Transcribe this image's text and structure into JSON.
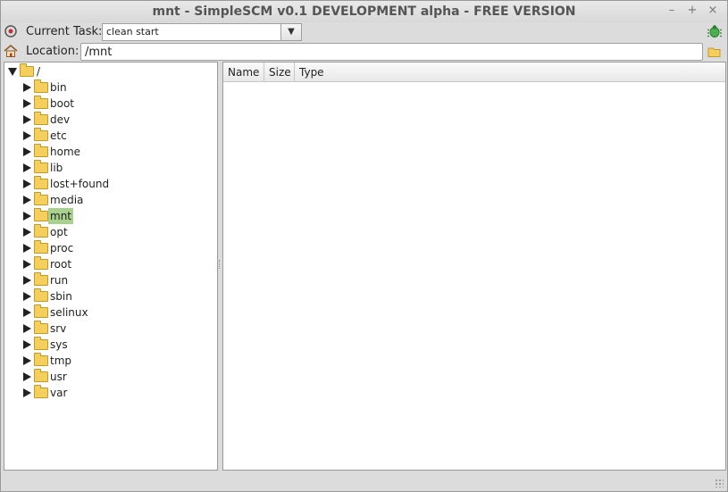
{
  "window": {
    "title": "mnt - SimpleSCM v0.1 DEVELOPMENT alpha - FREE VERSION",
    "controls": [
      "–",
      "+",
      "×"
    ]
  },
  "task": {
    "label": "Current Task:",
    "value": "clean start",
    "dropdown_glyph": "▼"
  },
  "location": {
    "label": "Location:",
    "value": "/mnt"
  },
  "tree": {
    "root_label": "/",
    "selected": "mnt",
    "items": [
      "bin",
      "boot",
      "dev",
      "etc",
      "home",
      "lib",
      "lost+found",
      "media",
      "mnt",
      "opt",
      "proc",
      "root",
      "run",
      "sbin",
      "selinux",
      "srv",
      "sys",
      "tmp",
      "usr",
      "var"
    ]
  },
  "file_list": {
    "columns": [
      "Name",
      "Size",
      "Type"
    ],
    "rows": []
  },
  "colors": {
    "selection": "#a9d18e",
    "folder": "#f5cf5c"
  }
}
